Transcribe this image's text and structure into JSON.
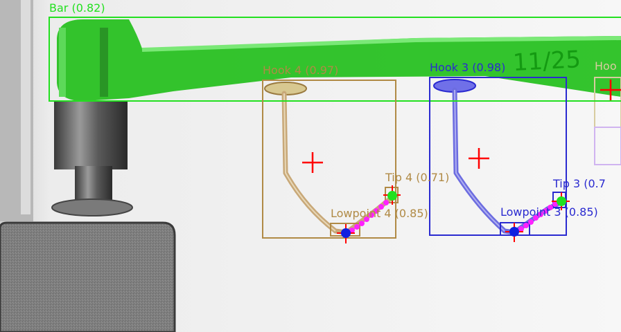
{
  "detections": {
    "bar": {
      "label": "Bar (0.82)",
      "color": "#22e01f"
    },
    "hook4": {
      "label": "Hook 4 (0.97)",
      "color": "#b08a45"
    },
    "hook3": {
      "label": "Hook 3 (0.98)",
      "color": "#2a2ad0"
    },
    "hook_partial": {
      "label": "Hoo",
      "color": "#d8cca0"
    },
    "tip4": {
      "label": "Tip 4 (0.71)",
      "color": "#b08a45"
    },
    "tip3": {
      "label": "Tip 3 (0.7",
      "color": "#2a2ad0"
    },
    "lowpoint4": {
      "label": "Lowpoint 4 (0.85)",
      "color": "#b08a45"
    },
    "lowpoint3": {
      "label": "Lowpoint 3 (0.85)",
      "color": "#2a2ad0"
    }
  },
  "bar_engraving": "11/25",
  "marker_colors": {
    "center_cross": "#ff0000",
    "tip_point": "#22e01f",
    "lowpoint_point": "#1020e0",
    "path": "#ff22ff"
  }
}
